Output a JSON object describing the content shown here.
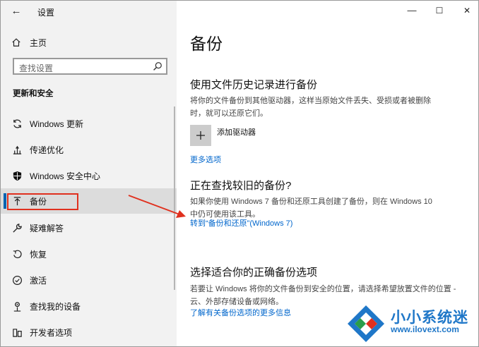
{
  "window": {
    "title": "设置",
    "controls": {
      "minimize": "—",
      "maximize": "☐",
      "close": "✕"
    }
  },
  "sidebar": {
    "home_label": "主页",
    "search_placeholder": "查找设置",
    "section_heading": "更新和安全",
    "items": [
      {
        "label": "Windows 更新",
        "icon": "sync-icon"
      },
      {
        "label": "传递优化",
        "icon": "delivery-optimization-icon"
      },
      {
        "label": "Windows 安全中心",
        "icon": "shield-icon"
      },
      {
        "label": "备份",
        "icon": "backup-arrow-icon",
        "active": true
      },
      {
        "label": "疑难解答",
        "icon": "wrench-icon"
      },
      {
        "label": "恢复",
        "icon": "recovery-icon"
      },
      {
        "label": "激活",
        "icon": "check-circle-icon"
      },
      {
        "label": "查找我的设备",
        "icon": "find-device-icon"
      },
      {
        "label": "开发者选项",
        "icon": "developer-icon"
      }
    ]
  },
  "main": {
    "title": "备份",
    "file_history": {
      "heading": "使用文件历史记录进行备份",
      "desc_line1": "将你的文件备份到其他驱动器，这样当原始文件丢失、受损或者被删除",
      "desc_line2": "时，就可以还原它们。",
      "add_drive": "添加驱动器",
      "more_options": "更多选项"
    },
    "older_backup": {
      "heading": "正在查找较旧的备份?",
      "desc_line1": "如果你使用 Windows 7 备份和还原工具创建了备份，则在 Windows 10",
      "desc_line2": "中仍可使用该工具。",
      "link": "转到“备份和还原”(Windows 7)"
    },
    "choose": {
      "heading": "选择适合你的正确备份选项",
      "desc_line1": "若要让 Windows 将你的文件备份到安全的位置，请选择希望放置文件的位置 -",
      "desc_line2": "云、外部存储设备或网络。",
      "link": "了解有关备份选项的更多信息"
    }
  },
  "watermark": {
    "brand": "小小系统迷",
    "url": "www.ilovext.com"
  },
  "colors": {
    "accent": "#0063b1",
    "link": "#0066cc",
    "highlight": "#e0301e"
  }
}
